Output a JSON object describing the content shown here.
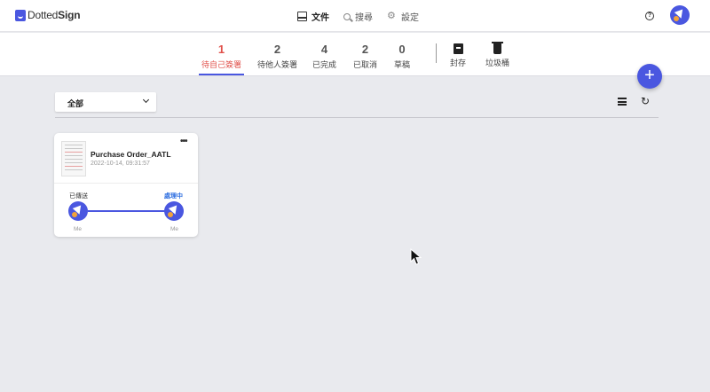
{
  "app": {
    "logo_text_a": "Dotted",
    "logo_text_b": "Sign"
  },
  "nav": [
    {
      "label": "文件",
      "icon": "document-icon",
      "active": true
    },
    {
      "label": "搜尋",
      "icon": "search-icon",
      "active": false
    },
    {
      "label": "設定",
      "icon": "gear-icon",
      "active": false
    }
  ],
  "header": {
    "help_icon": "?"
  },
  "tabs": [
    {
      "count": "1",
      "label": "待自己簽署",
      "active": true
    },
    {
      "count": "2",
      "label": "待他人簽署"
    },
    {
      "count": "4",
      "label": "已完成"
    },
    {
      "count": "2",
      "label": "已取消"
    },
    {
      "count": "0",
      "label": "草稿"
    }
  ],
  "tab_actions": [
    {
      "label": "封存",
      "icon": "archive-icon"
    },
    {
      "label": "垃圾桶",
      "icon": "trash-icon"
    }
  ],
  "fab": {
    "label": "+"
  },
  "filter": {
    "value": "全部"
  },
  "document": {
    "title": "Purchase Order_AATL",
    "date": "2022-10-14, 09:31:57",
    "more": "•••",
    "status_left": "已傳送",
    "status_right": "處理中",
    "signer_left": "Me",
    "signer_right": "Me"
  },
  "colors": {
    "accent": "#4a57e0",
    "active_tab": "#e0504a",
    "processing": "#2f6fe0",
    "avatar_dot": "#f2a33a"
  }
}
